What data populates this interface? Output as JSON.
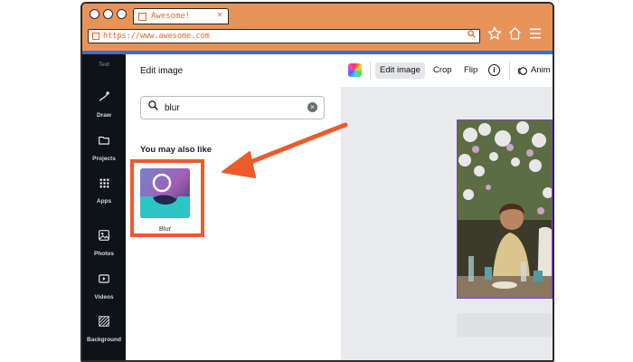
{
  "browser": {
    "tab_title": "Awesome!",
    "tab_close": "✕",
    "url": "https://www.awesome.com"
  },
  "sidebar": {
    "partial_label": "Text",
    "items": [
      {
        "label": "Draw",
        "icon": "draw-icon"
      },
      {
        "label": "Projects",
        "icon": "folder-icon"
      },
      {
        "label": "Apps",
        "icon": "apps-grid-icon"
      },
      {
        "label": "Photos",
        "icon": "photo-icon"
      },
      {
        "label": "Videos",
        "icon": "video-icon"
      },
      {
        "label": "Background",
        "icon": "background-icon"
      }
    ]
  },
  "panel": {
    "title": "Edit image",
    "search_value": "blur",
    "clear_symbol": "×",
    "section_title": "You may also like",
    "apps": [
      {
        "label": "Blur"
      }
    ]
  },
  "toolbar": {
    "edit_image": "Edit image",
    "crop": "Crop",
    "flip": "Flip",
    "info": "i",
    "animate": "Anim"
  },
  "colors": {
    "chrome": "#e8935a",
    "url_text": "#e06a2a",
    "accent_blue": "#2f74d6",
    "sidebar": "#0e1318",
    "highlight": "#ee5a29",
    "selection": "#7b3fe4"
  }
}
